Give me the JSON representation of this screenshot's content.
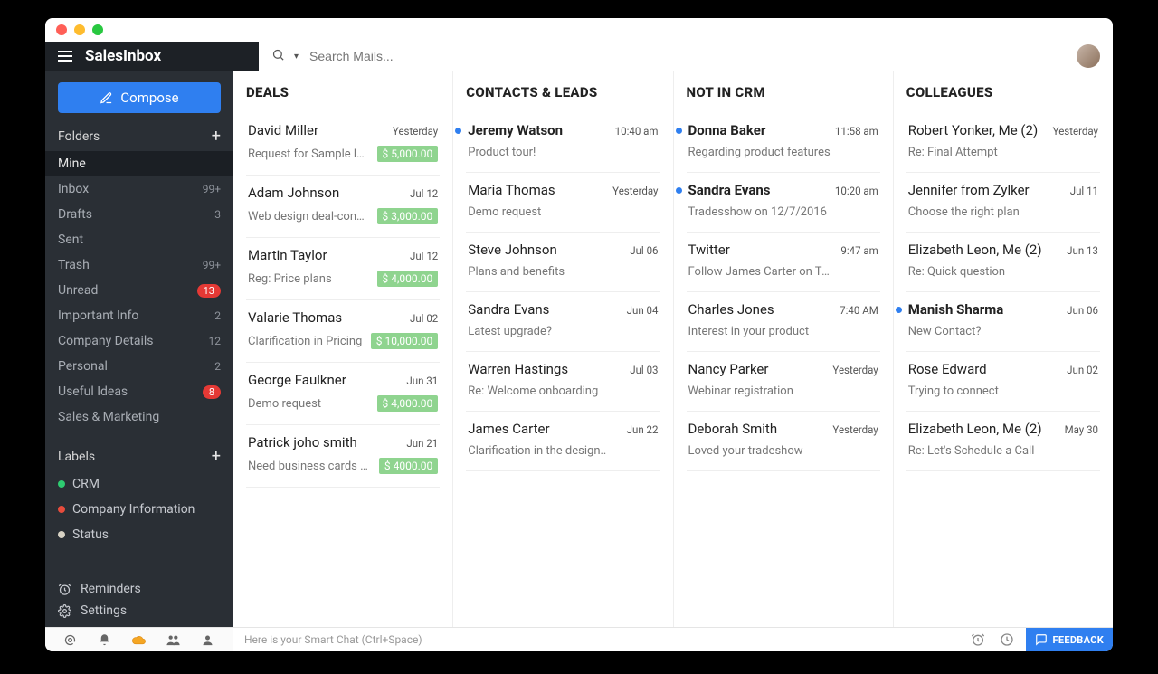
{
  "header": {
    "app_name": "SalesInbox",
    "search_placeholder": "Search Mails..."
  },
  "sidebar": {
    "compose_label": "Compose",
    "folders_title": "Folders",
    "labels_title": "Labels",
    "reminders_label": "Reminders",
    "settings_label": "Settings",
    "folders": [
      {
        "name": "Mine",
        "count": "",
        "selected": true
      },
      {
        "name": "Inbox",
        "count": "99+"
      },
      {
        "name": "Drafts",
        "count": "3"
      },
      {
        "name": "Sent",
        "count": ""
      },
      {
        "name": "Trash",
        "count": "99+"
      },
      {
        "name": "Unread",
        "count": "13",
        "badge": true
      },
      {
        "name": "Important Info",
        "count": "2"
      },
      {
        "name": "Company Details",
        "count": "12"
      },
      {
        "name": "Personal",
        "count": "2"
      },
      {
        "name": "Useful Ideas",
        "count": "8",
        "badge": true
      },
      {
        "name": "Sales & Marketing",
        "count": ""
      }
    ],
    "labels": [
      {
        "name": "CRM",
        "color": "#2ecc71"
      },
      {
        "name": "Company Information",
        "color": "#e74c3c"
      },
      {
        "name": "Status",
        "color": "#d7d2c4"
      }
    ]
  },
  "columns": [
    {
      "title": "DEALS",
      "mails": [
        {
          "sender": "David Miller",
          "time": "Yesterday",
          "subject": "Request for Sample logo...",
          "amount": "$ 5,000.00"
        },
        {
          "sender": "Adam Johnson",
          "time": "Jul 12",
          "subject": "Web design deal-confirmat...",
          "amount": "$ 3,000.00"
        },
        {
          "sender": "Martin Taylor",
          "time": "Jul 12",
          "subject": "Reg: Price plans",
          "amount": "$ 4,000.00"
        },
        {
          "sender": "Valarie Thomas",
          "time": "Jul 02",
          "subject": "Clarification in Pricing",
          "amount": "$ 10,000.00"
        },
        {
          "sender": "George Faulkner",
          "time": "Jun 31",
          "subject": "Demo request",
          "amount": "$ 4,000.00"
        },
        {
          "sender": "Patrick joho smith",
          "time": "Jun 21",
          "subject": "Need business cards desi...",
          "amount": "$ 4000.00"
        }
      ]
    },
    {
      "title": "CONTACTS & LEADS",
      "mails": [
        {
          "sender": "Jeremy Watson",
          "time": "10:40 am",
          "subject": "Product tour!",
          "unread": true
        },
        {
          "sender": "Maria Thomas",
          "time": "Yesterday",
          "subject": "Demo request"
        },
        {
          "sender": "Steve Johnson",
          "time": "Jul 06",
          "subject": "Plans and benefits"
        },
        {
          "sender": "Sandra Evans",
          "time": "Jun 04",
          "subject": "Latest upgrade?"
        },
        {
          "sender": "Warren Hastings",
          "time": "Jul 03",
          "subject": "Re: Welcome onboarding"
        },
        {
          "sender": "James Carter",
          "time": "Jun 22",
          "subject": "Clarification in the design.."
        }
      ]
    },
    {
      "title": "NOT IN CRM",
      "mails": [
        {
          "sender": "Donna Baker",
          "time": "11:58 am",
          "subject": "Regarding product features",
          "unread": true
        },
        {
          "sender": "Sandra Evans",
          "time": "10:20 am",
          "subject": "Tradesshow on 12/7/2016",
          "unread": true
        },
        {
          "sender": "Twitter",
          "time": "9:47 am",
          "subject": "Follow James Carter on Twitter!"
        },
        {
          "sender": "Charles Jones",
          "time": "7:40 AM",
          "subject": "Interest in your product"
        },
        {
          "sender": "Nancy Parker",
          "time": "Yesterday",
          "subject": "Webinar registration"
        },
        {
          "sender": "Deborah Smith",
          "time": "Yesterday",
          "subject": "Loved your tradeshow"
        }
      ]
    },
    {
      "title": "COLLEAGUES",
      "mails": [
        {
          "sender": "Robert Yonker, Me (2)",
          "time": "Yesterday",
          "subject": "Re: Final Attempt"
        },
        {
          "sender": "Jennifer from Zylker",
          "time": "Jul 11",
          "subject": "Choose the right plan"
        },
        {
          "sender": "Elizabeth Leon, Me (2)",
          "time": "Jun 13",
          "subject": "Re: Quick question"
        },
        {
          "sender": "Manish Sharma",
          "time": "Jun 06",
          "subject": "New Contact?",
          "unread": true
        },
        {
          "sender": "Rose Edward",
          "time": "Jun 02",
          "subject": "Trying to connect"
        },
        {
          "sender": "Elizabeth Leon, Me (2)",
          "time": "May 30",
          "subject": "Re: Let's Schedule a Call"
        }
      ]
    }
  ],
  "footer": {
    "smart_chat_placeholder": "Here is your Smart Chat (Ctrl+Space)",
    "feedback_label": "FEEDBACK"
  }
}
